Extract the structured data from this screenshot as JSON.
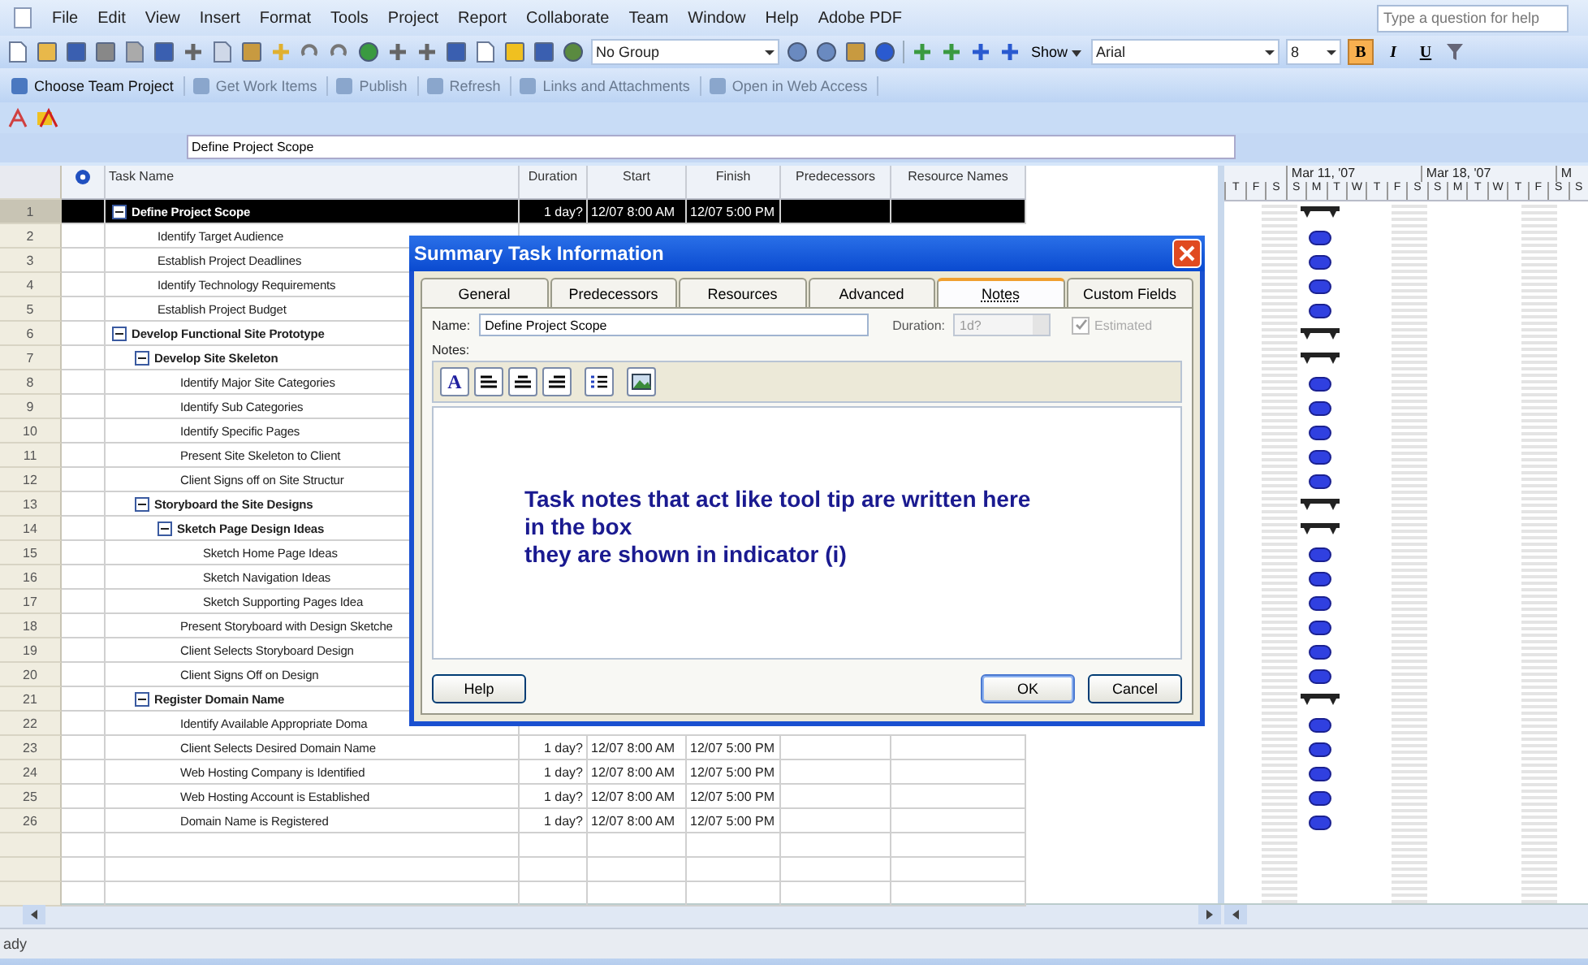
{
  "menu": [
    "File",
    "Edit",
    "View",
    "Insert",
    "Format",
    "Tools",
    "Project",
    "Report",
    "Collaborate",
    "Team",
    "Window",
    "Help",
    "Adobe PDF"
  ],
  "help_box": {
    "placeholder": "Type a question for help"
  },
  "toolbar": {
    "group": "No Group",
    "show": "Show",
    "font": "Arial",
    "size": "8",
    "format_buttons": [
      {
        "label": "B",
        "selected": true
      },
      {
        "label": "I",
        "selected": false
      },
      {
        "label": "U",
        "selected": false
      }
    ]
  },
  "team_toolbar": [
    {
      "label": "Choose Team Project",
      "disabled": false
    },
    {
      "label": "Get Work Items",
      "disabled": true
    },
    {
      "label": "Publish",
      "disabled": true
    },
    {
      "label": "Refresh",
      "disabled": true
    },
    {
      "label": "Links and Attachments",
      "disabled": true
    },
    {
      "label": "Open in Web Access",
      "disabled": true
    }
  ],
  "entry_bar": {
    "value": "Define Project Scope"
  },
  "table": {
    "columns": [
      "Task Name",
      "Duration",
      "Start",
      "Finish",
      "Predecessors",
      "Resource Names"
    ],
    "tasks": [
      {
        "id": "1",
        "name": "Define Project Scope",
        "kind": "summary",
        "expanded": true,
        "selected": true,
        "duration": "1 day?",
        "start": "12/07 8:00 AM",
        "finish": "12/07 5:00 PM",
        "children": [
          {
            "id": "2",
            "name": "Identify Target Audience",
            "kind": "task",
            "selected": false
          },
          {
            "id": "3",
            "name": "Establish Project Deadlines",
            "kind": "task",
            "selected": false
          },
          {
            "id": "4",
            "name": "Identify Technology Requirements",
            "kind": "task",
            "selected": false
          },
          {
            "id": "5",
            "name": "Establish Project Budget",
            "kind": "task",
            "selected": false
          }
        ]
      },
      {
        "id": "6",
        "name": "Develop Functional Site Prototype",
        "kind": "summary",
        "expanded": true,
        "selected": false,
        "children": [
          {
            "id": "7",
            "name": "Develop Site Skeleton",
            "kind": "summary",
            "expanded": true,
            "selected": false,
            "children": [
              {
                "id": "8",
                "name": "Identify Major Site Categories",
                "kind": "task",
                "selected": false
              },
              {
                "id": "9",
                "name": "Identify Sub Categories",
                "kind": "task",
                "selected": false
              },
              {
                "id": "10",
                "name": "Identify Specific Pages",
                "kind": "task",
                "selected": false
              },
              {
                "id": "11",
                "name": "Present Site Skeleton to Client",
                "kind": "task",
                "selected": false
              },
              {
                "id": "12",
                "name": "Client Signs off on Site Structur",
                "kind": "task",
                "selected": false
              }
            ]
          },
          {
            "id": "13",
            "name": "Storyboard the Site Designs",
            "kind": "summary",
            "expanded": true,
            "selected": false,
            "children": [
              {
                "id": "14",
                "name": "Sketch Page Design Ideas",
                "kind": "summary",
                "expanded": true,
                "selected": false,
                "children": [
                  {
                    "id": "15",
                    "name": "Sketch Home Page Ideas",
                    "kind": "task",
                    "selected": false
                  },
                  {
                    "id": "16",
                    "name": "Sketch Navigation Ideas",
                    "kind": "task",
                    "selected": false
                  },
                  {
                    "id": "17",
                    "name": "Sketch Supporting Pages Idea",
                    "kind": "task",
                    "selected": false
                  }
                ]
              },
              {
                "id": "18",
                "name": "Present Storyboard with Design Sketche",
                "kind": "task",
                "selected": false
              },
              {
                "id": "19",
                "name": "Client Selects Storyboard Design",
                "kind": "task",
                "selected": false
              },
              {
                "id": "20",
                "name": "Client Signs Off on Design",
                "kind": "task",
                "selected": false
              }
            ]
          },
          {
            "id": "21",
            "name": "Register Domain Name",
            "kind": "summary",
            "expanded": true,
            "selected": false,
            "children": [
              {
                "id": "22",
                "name": "Identify Available Appropriate Doma",
                "kind": "task",
                "selected": false
              },
              {
                "id": "23",
                "name": "Client Selects Desired Domain Name",
                "kind": "task",
                "selected": false,
                "duration": "1 day?",
                "start": "12/07 8:00 AM",
                "finish": "12/07 5:00 PM"
              },
              {
                "id": "24",
                "name": "Web Hosting Company is Identified",
                "kind": "task",
                "selected": false,
                "duration": "1 day?",
                "start": "12/07 8:00 AM",
                "finish": "12/07 5:00 PM"
              },
              {
                "id": "25",
                "name": "Web Hosting Account is Established",
                "kind": "task",
                "selected": false,
                "duration": "1 day?",
                "start": "12/07 8:00 AM",
                "finish": "12/07 5:00 PM"
              },
              {
                "id": "26",
                "name": "Domain Name is Registered",
                "kind": "task",
                "selected": false,
                "duration": "1 day?",
                "start": "12/07 8:00 AM",
                "finish": "12/07 5:00 PM"
              }
            ]
          }
        ]
      }
    ]
  },
  "gantt": {
    "weeks": [
      "Mar 11, '07",
      "Mar 18, '07",
      "M"
    ],
    "days": [
      "T",
      "F",
      "S",
      "S",
      "M",
      "T",
      "W",
      "T",
      "F",
      "S",
      "S",
      "M",
      "T",
      "W",
      "T",
      "F",
      "S",
      "S"
    ]
  },
  "dialog": {
    "title": "Summary Task Information",
    "tabs": [
      {
        "label": "General",
        "selected": false
      },
      {
        "label": "Predecessors",
        "selected": false
      },
      {
        "label": "Resources",
        "selected": false
      },
      {
        "label": "Advanced",
        "selected": false
      },
      {
        "label": "Notes",
        "selected": true
      },
      {
        "label": "Custom Fields",
        "selected": false
      }
    ],
    "name_label": "Name:",
    "name": "Define Project Scope",
    "duration_label": "Duration:",
    "duration": "1d?",
    "estimated": {
      "label": "Estimated",
      "checked": true,
      "disabled": true
    },
    "notes_label": "Notes:",
    "font_button": "A",
    "notes": [
      "Task notes that act like tool tip are written here",
      "in the box",
      "they are shown in indicator (i)"
    ],
    "buttons": {
      "help": "Help",
      "ok": "OK",
      "cancel": "Cancel"
    }
  },
  "status_bar": "ady"
}
